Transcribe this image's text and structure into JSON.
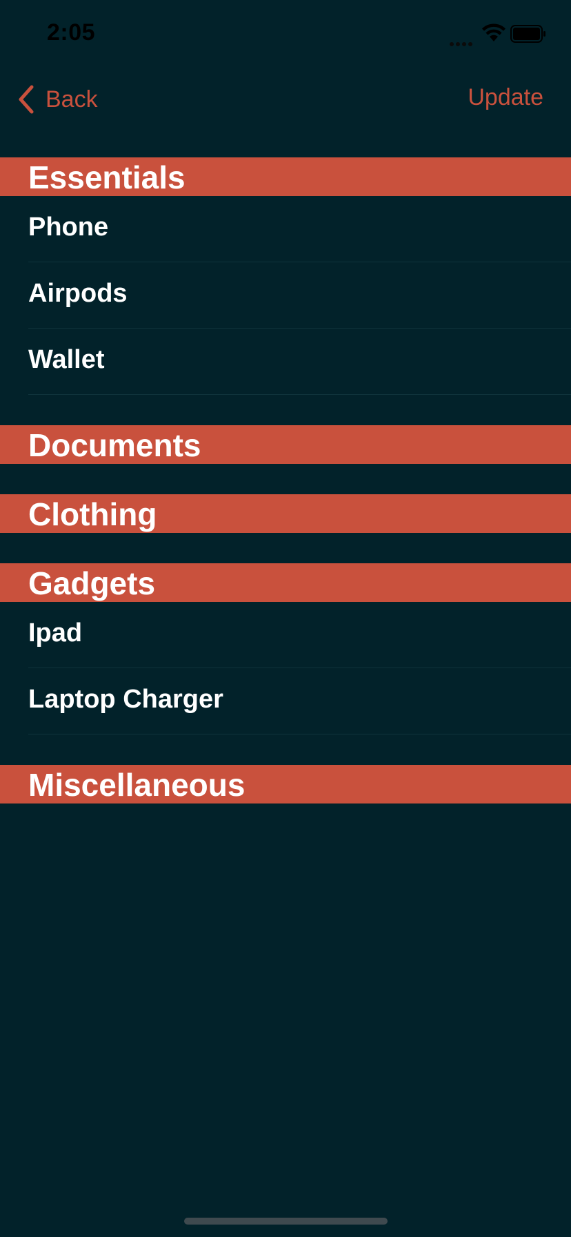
{
  "status_bar": {
    "time": "2:05"
  },
  "nav": {
    "back_label": "Back",
    "update_label": "Update"
  },
  "colors": {
    "background": "#02222a",
    "accent": "#c9513d",
    "text": "#ffffff"
  },
  "sections": [
    {
      "title": "Essentials",
      "items": [
        "Phone",
        "Airpods",
        "Wallet"
      ]
    },
    {
      "title": "Documents",
      "items": []
    },
    {
      "title": "Clothing",
      "items": []
    },
    {
      "title": "Gadgets",
      "items": [
        "Ipad",
        "Laptop Charger"
      ]
    },
    {
      "title": "Miscellaneous",
      "items": []
    }
  ]
}
